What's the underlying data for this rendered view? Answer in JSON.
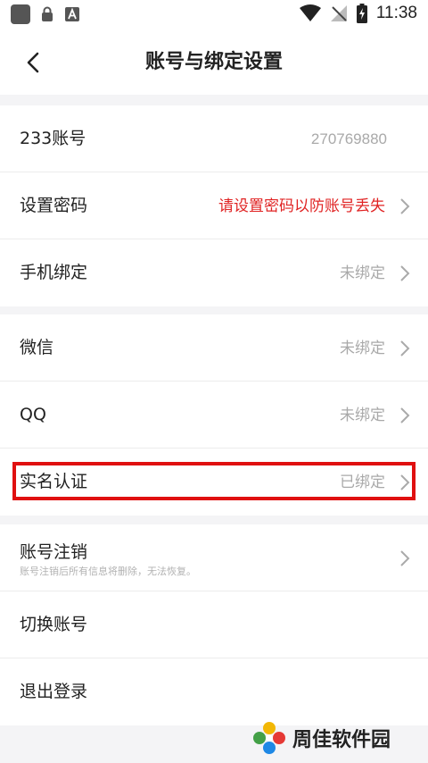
{
  "status_bar": {
    "time": "11:38"
  },
  "header": {
    "title": "账号与绑定设置"
  },
  "group1": [
    {
      "label": "233账号",
      "value": "270769880"
    },
    {
      "label": "设置密码",
      "value": "请设置密码以防账号丢失"
    },
    {
      "label": "手机绑定",
      "value": "未绑定"
    }
  ],
  "group2": [
    {
      "label": "微信",
      "value": "未绑定"
    },
    {
      "label": "QQ",
      "value": "未绑定"
    },
    {
      "label": "实名认证",
      "value": "已绑定"
    }
  ],
  "group3": {
    "cancel": {
      "label": "账号注销",
      "sub": "账号注销后所有信息将删除，无法恢复。"
    },
    "switch": {
      "label": "切换账号"
    },
    "logout": {
      "label": "退出登录"
    }
  },
  "watermark": {
    "text": "周佳软件园"
  },
  "colors": {
    "warn": "#e02323",
    "highlight": "#e01010",
    "muted": "#a9a9a9"
  }
}
